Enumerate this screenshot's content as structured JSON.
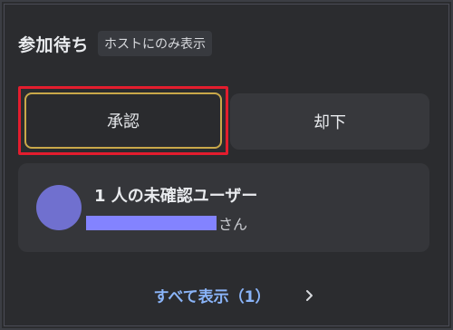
{
  "header": {
    "title": "参加待ち",
    "host_badge": "ホストにのみ表示"
  },
  "actions": {
    "approve_label": "承認",
    "deny_label": "却下"
  },
  "pending": {
    "summary": "1 人の未確認ユーザー",
    "name_suffix": "さん"
  },
  "footer": {
    "show_all_label": "すべて表示（1）"
  },
  "colors": {
    "background": "#2b2c2f",
    "button": "#37383c",
    "link": "#8ab4f8",
    "avatar": "#7070cf",
    "highlight": "#e31d2e"
  },
  "icons": {
    "show_all": "chevron-right-icon"
  }
}
